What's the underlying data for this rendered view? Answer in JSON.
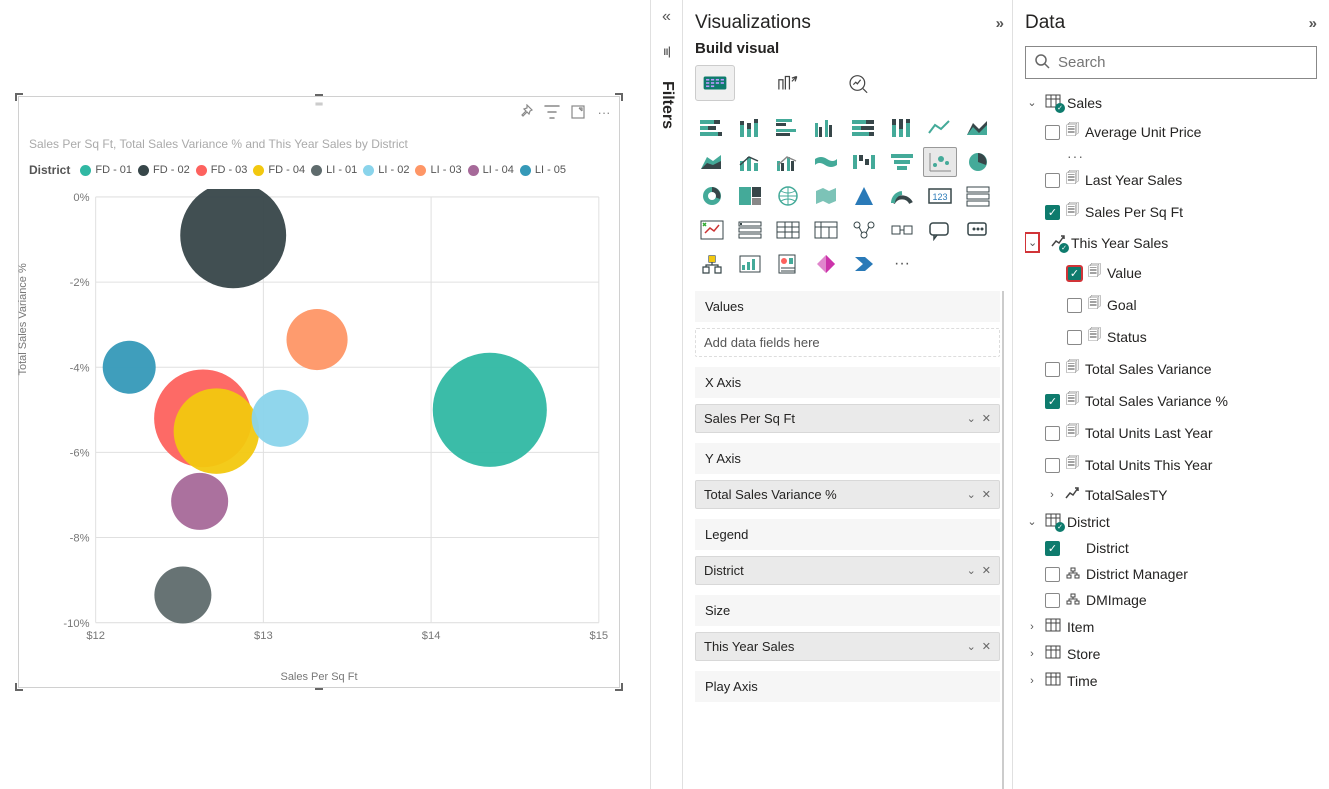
{
  "chart_data": {
    "type": "scatter",
    "title": "Sales Per Sq Ft, Total Sales Variance % and This Year Sales by District",
    "xlabel": "Sales Per Sq Ft",
    "ylabel": "Total Sales Variance %",
    "xlim": [
      12,
      15
    ],
    "ylim": [
      -10,
      0
    ],
    "x_ticks": [
      "$12",
      "$13",
      "$14",
      "$15"
    ],
    "y_ticks": [
      "0%",
      "-2%",
      "-4%",
      "-6%",
      "-8%",
      "-10%"
    ],
    "legend_title": "District",
    "series": [
      {
        "name": "FD - 01",
        "color": "#30b8a3",
        "x": 14.35,
        "y": -5.0,
        "size": 56
      },
      {
        "name": "FD - 02",
        "color": "#374649",
        "x": 12.82,
        "y": -0.9,
        "size": 52
      },
      {
        "name": "FD - 03",
        "color": "#fd625e",
        "x": 12.64,
        "y": -5.2,
        "size": 48
      },
      {
        "name": "FD - 04",
        "color": "#f2c80f",
        "x": 12.72,
        "y": -5.5,
        "size": 42
      },
      {
        "name": "LI - 01",
        "color": "#5f6b6d",
        "x": 12.52,
        "y": -9.35,
        "size": 28
      },
      {
        "name": "LI - 02",
        "color": "#8ad4eb",
        "x": 13.1,
        "y": -5.2,
        "size": 28
      },
      {
        "name": "LI - 03",
        "color": "#fe9666",
        "x": 13.32,
        "y": -3.35,
        "size": 30
      },
      {
        "name": "LI - 04",
        "color": "#a66999",
        "x": 12.62,
        "y": -7.15,
        "size": 28
      },
      {
        "name": "LI - 05",
        "color": "#3599b8",
        "x": 12.2,
        "y": -4.0,
        "size": 26
      }
    ]
  },
  "visual_header": {
    "pin_tooltip": "Pin",
    "focus_tooltip": "Focus mode",
    "more_tooltip": "More options"
  },
  "filters_label": "Filters",
  "viz_pane": {
    "title": "Visualizations",
    "subtitle": "Build visual",
    "wells": {
      "values": {
        "label": "Values",
        "placeholder": "Add data fields here"
      },
      "xaxis": {
        "label": "X Axis",
        "field": "Sales Per Sq Ft"
      },
      "yaxis": {
        "label": "Y Axis",
        "field": "Total Sales Variance %"
      },
      "legend": {
        "label": "Legend",
        "field": "District"
      },
      "size": {
        "label": "Size",
        "field": "This Year Sales"
      },
      "play": {
        "label": "Play Axis"
      }
    }
  },
  "data_pane": {
    "title": "Data",
    "search_placeholder": "Search",
    "tables": {
      "sales": {
        "name": "Sales",
        "fields": {
          "avg_unit_price": "Average Unit Price",
          "last_year_sales": "Last Year Sales",
          "sales_per_sqft": "Sales Per Sq Ft",
          "this_year_sales": "This Year Sales",
          "tys_value": "Value",
          "tys_goal": "Goal",
          "tys_status": "Status",
          "total_sales_variance": "Total Sales Variance",
          "total_sales_variance_pct": "Total Sales Variance %",
          "total_units_last_year": "Total Units Last Year",
          "total_units_this_year": "Total Units This Year",
          "total_sales_ty": "TotalSalesTY"
        }
      },
      "district": {
        "name": "District",
        "fields": {
          "district": "District",
          "district_manager": "District Manager",
          "dm_image": "DMImage"
        }
      },
      "item": {
        "name": "Item"
      },
      "store": {
        "name": "Store"
      },
      "time": {
        "name": "Time"
      }
    }
  }
}
